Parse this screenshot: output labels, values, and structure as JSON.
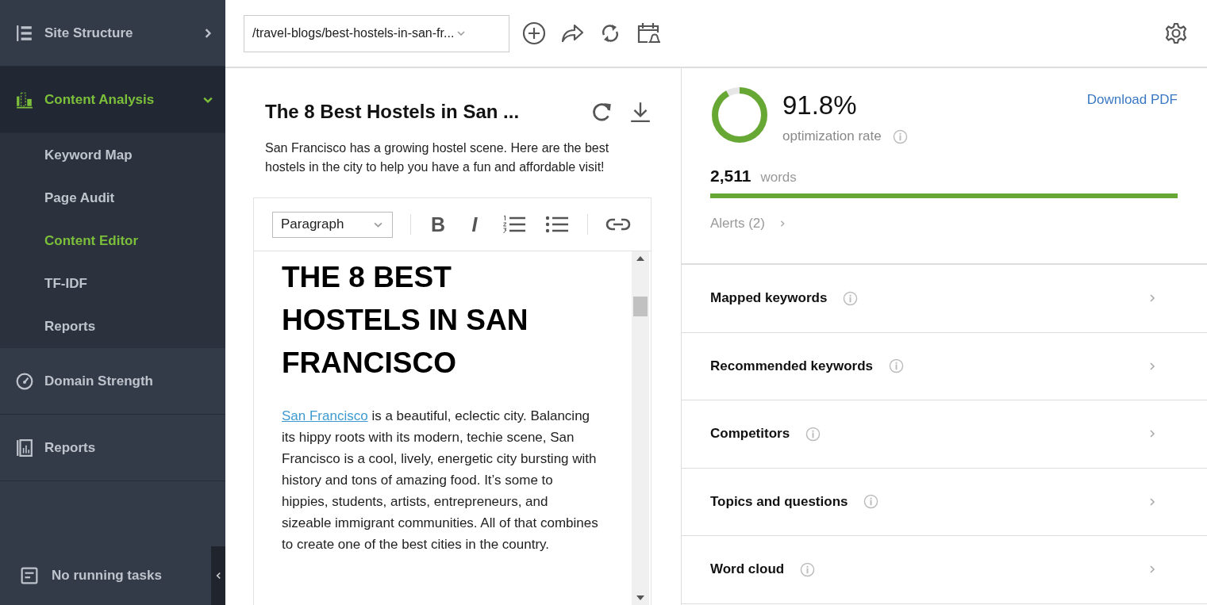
{
  "sidebar": {
    "items": [
      {
        "label": "Site Structure",
        "expanded": false,
        "selected": false
      },
      {
        "label": "Content Analysis",
        "expanded": true,
        "selected": true,
        "children": [
          {
            "label": "Keyword Map",
            "selected": false
          },
          {
            "label": "Page Audit",
            "selected": false
          },
          {
            "label": "Content Editor",
            "selected": true
          },
          {
            "label": "TF-IDF",
            "selected": false
          },
          {
            "label": "Reports",
            "selected": false
          }
        ]
      },
      {
        "label": "Domain Strength",
        "selected": false
      },
      {
        "label": "Reports",
        "selected": false
      }
    ],
    "status": "No running tasks"
  },
  "toolbar": {
    "url": "/travel-blogs/best-hostels-in-san-fr..."
  },
  "editor": {
    "title": "The 8 Best Hostels in San ...",
    "description": "San Francisco has a growing hostel scene. Here are the best hostels in the city to help you have a fun and affordable visit!",
    "block_format": "Paragraph",
    "format_buttons": [
      "B",
      "I"
    ],
    "heading": "THE 8 BEST HOSTELS IN SAN FRANCISCO",
    "paragraph_link": "San Francisco",
    "paragraph_text": " is a beautiful, eclectic city. Balancing its hippy roots with its modern, techie scene, San Francisco is a cool, lively, energetic city bursting with history and tons of amazing food. It’s some to hippies, students, artists, entrepreneurs, and sizeable immigrant communities. All of that combines to create one of the best cities in the country."
  },
  "analysis": {
    "rate": "91.8%",
    "rate_meter": {
      "level": 0.918
    },
    "rate_label": "optimization rate",
    "download": "Download PDF",
    "word_count": "2,511",
    "word_label": "words",
    "words_bar": {
      "level": 1
    },
    "alerts": "Alerts (2)",
    "sections": [
      {
        "label": "Mapped keywords"
      },
      {
        "label": "Recommended keywords"
      },
      {
        "label": "Competitors"
      },
      {
        "label": "Topics and questions"
      },
      {
        "label": "Word cloud"
      }
    ]
  }
}
